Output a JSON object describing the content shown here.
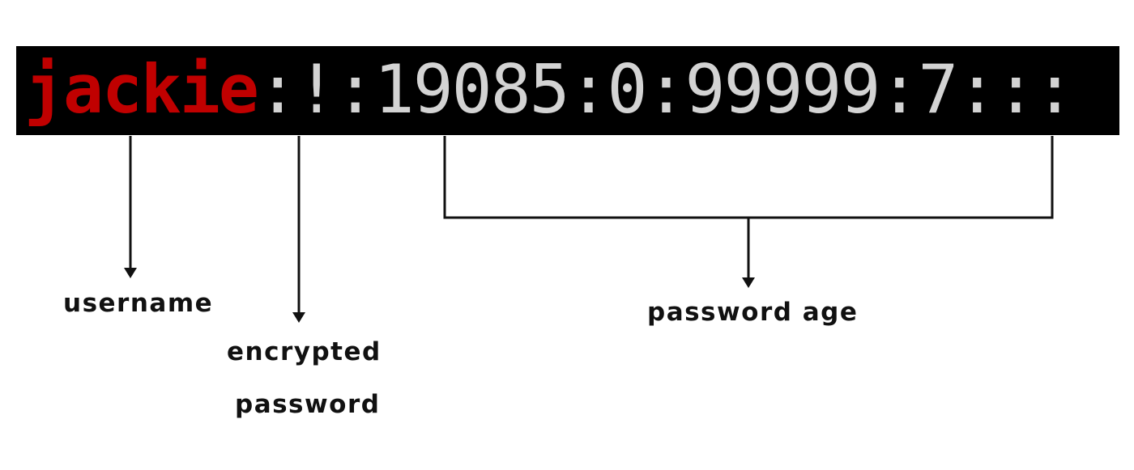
{
  "terminal": {
    "username": "jackie",
    "rest": ":!:19085:0:99999:7:::",
    "colors": {
      "background": "#000000",
      "username": "#c00000",
      "text": "#d3d3d3"
    }
  },
  "labels": {
    "username": "username",
    "encrypted_line1": "encrypted",
    "encrypted_line2": "password",
    "password_age": "password age"
  }
}
